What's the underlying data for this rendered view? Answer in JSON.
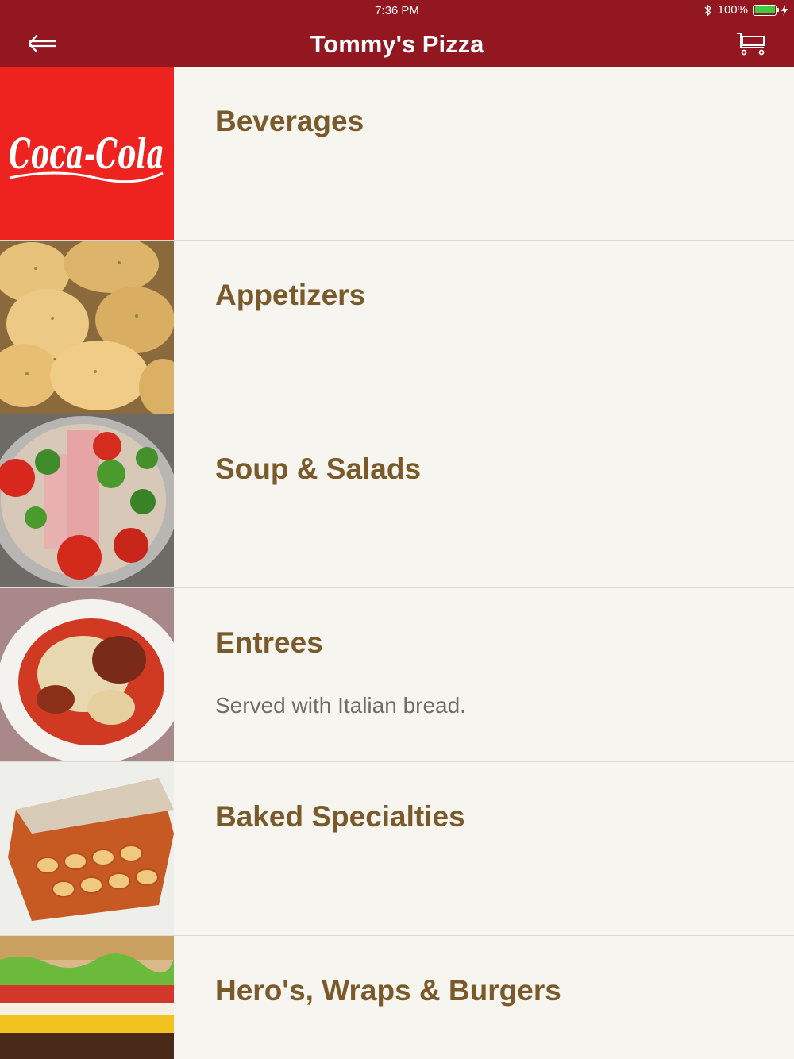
{
  "status_bar": {
    "time": "7:36 PM",
    "battery": "100%"
  },
  "nav": {
    "title": "Tommy's Pizza",
    "back_icon": "back-arrow-icon",
    "cart_icon": "cart-icon"
  },
  "menu": [
    {
      "title": "Beverages",
      "description": "",
      "image": "coca-cola-logo"
    },
    {
      "title": "Appetizers",
      "description": "",
      "image": "garlic-knots-photo"
    },
    {
      "title": "Soup & Salads",
      "description": "",
      "image": "antipasto-salad-photo"
    },
    {
      "title": "Entrees",
      "description": "Served with Italian bread.",
      "image": "parmigiana-plate-photo"
    },
    {
      "title": "Baked Specialties",
      "description": "",
      "image": "baked-ziti-photo"
    },
    {
      "title": "Hero's, Wraps & Burgers",
      "description": "",
      "image": "burger-photo"
    }
  ],
  "colors": {
    "header": "#921720",
    "title_text": "#7a5a2a",
    "background": "#f6f5f0",
    "brand_red": "#e8221c"
  }
}
